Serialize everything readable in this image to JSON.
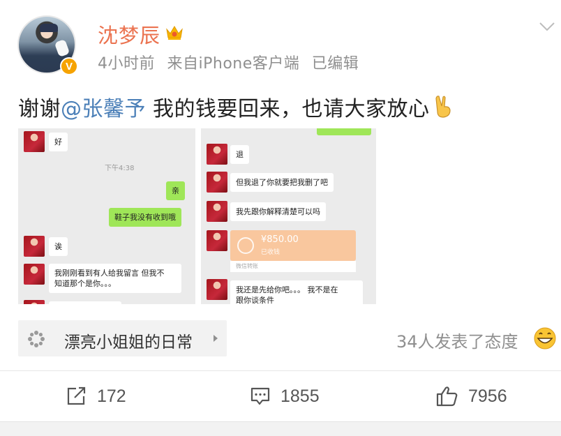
{
  "header": {
    "username": "沈梦辰",
    "time": "4小时前",
    "source": "来自iPhone客户端",
    "edited": "已编辑",
    "verified_badge": "V"
  },
  "post": {
    "prefix": "谢谢",
    "mention": "@张馨予",
    "text": " 我的钱要回来，也请大家放心"
  },
  "chat_left": {
    "msg1": "好",
    "timestamp": "下午4:38",
    "msg2": "亲",
    "msg3": "鞋子我没有收到哦",
    "msg4": "诶",
    "msg5a": "我刚刚看到有人给我留言 但我不",
    "msg5b": "知道那个是你。。。"
  },
  "chat_right": {
    "msg1": "退",
    "msg2": "但我退了你就要把我删了吧",
    "msg3": "我先跟你解释清楚可以吗",
    "money_amount": "¥850.00",
    "money_sub": "已收钱",
    "money_footer": "微信转账",
    "msg4a": "我还是先给你吧。。。 我不是在",
    "msg4b": "跟你谈条件"
  },
  "topic": {
    "label": "漂亮小姐姐的日常"
  },
  "attitude": {
    "text": "34人发表了态度"
  },
  "actions": {
    "repost_count": "172",
    "comment_count": "1855",
    "like_count": "7956"
  },
  "colors": {
    "username": "#eb7350",
    "mention": "#4c80b8",
    "badge": "#f6a300",
    "wechat_green": "#9fe658"
  }
}
